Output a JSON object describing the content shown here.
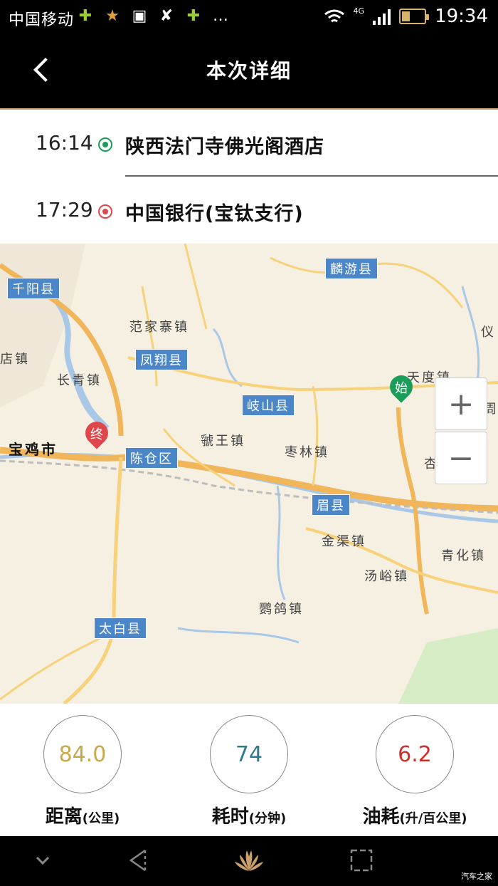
{
  "status_bar": {
    "carrier": "中国移动",
    "network": "4G",
    "time": "19:34",
    "battery_level": 0.35
  },
  "header": {
    "title": "本次详细"
  },
  "route": {
    "start": {
      "time": "16:14",
      "name": "陕西法门寺佛光阁酒店",
      "color": "#1a9e5a"
    },
    "end": {
      "time": "17:29",
      "name": "中国银行(宝钛支行)",
      "color": "#e0474c"
    }
  },
  "map": {
    "labels": {
      "qianyang": "千阳县",
      "linyou": "麟游县",
      "fanjiazhai": "范家寨镇",
      "fengxiang": "凤翔县",
      "changqing": "长青镇",
      "yi": "仪",
      "tiandu": "天度镇",
      "qishan": "岐山县",
      "zhou": "周",
      "baoji": "宝鸡市",
      "chencang": "陈仓区",
      "guowang": "虢王镇",
      "zaolin": "枣林镇",
      "xinglin": "杏林镇",
      "meixian": "眉县",
      "jinqu": "金渠镇",
      "qinghua": "青化镇",
      "tangyu": "汤峪镇",
      "yingge": "鹦鸽镇",
      "taibai": "太白县",
      "dian": "店镇",
      "k1": "天"
    },
    "start_marker": "始",
    "end_marker": "终",
    "zoom_in": "+",
    "zoom_out": "−"
  },
  "stats": {
    "distance": {
      "value": "84.0",
      "label": "距离",
      "unit": "(公里)",
      "color": "#c9a84a"
    },
    "duration": {
      "value": "74",
      "label": "耗时",
      "unit": "(分钟)",
      "color": "#2a7c8c"
    },
    "fuel": {
      "value": "6.2",
      "label": "油耗",
      "unit": "(升/百公里)",
      "color": "#d0302a"
    }
  },
  "watermark": "汽车之家"
}
